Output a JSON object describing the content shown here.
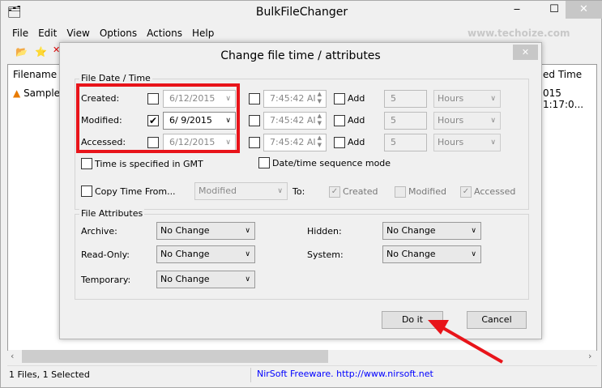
{
  "window": {
    "title": "BulkFileChanger",
    "minimize": "‒",
    "maximize": "☐",
    "close": "✕"
  },
  "menu": [
    "File",
    "Edit",
    "View",
    "Options",
    "Actions",
    "Help"
  ],
  "watermark": "www.techoize.com",
  "list": {
    "headers": [
      "Filename",
      "ed Time"
    ],
    "row": {
      "filename": "Sample",
      "time": "015 1:17:0..."
    }
  },
  "status": {
    "left": "1 Files, 1 Selected",
    "right": "NirSoft Freeware.  http://www.nirsoft.net"
  },
  "dialog": {
    "title": "Change file time / attributes",
    "close": "✕",
    "date_group": "File Date / Time",
    "rows": [
      {
        "label": "Created:",
        "checked": false,
        "date": "6/12/2015",
        "time": "7:45:42 AI",
        "add": "Add",
        "amount": "5",
        "unit": "Hours"
      },
      {
        "label": "Modified:",
        "checked": true,
        "date": "6/  9/2015",
        "time": "7:45:42 AI",
        "add": "Add",
        "amount": "5",
        "unit": "Hours"
      },
      {
        "label": "Accessed:",
        "checked": false,
        "date": "6/12/2015",
        "time": "7:45:42 AI",
        "add": "Add",
        "amount": "5",
        "unit": "Hours"
      }
    ],
    "gmt": "Time is specified in GMT",
    "sequence": "Date/time sequence mode",
    "copy_from": "Copy Time From...",
    "copy_source": "Modified",
    "to": "To:",
    "targets": [
      {
        "label": "Created",
        "checked": true
      },
      {
        "label": "Modified",
        "checked": false
      },
      {
        "label": "Accessed",
        "checked": true
      }
    ],
    "attr_group": "File Attributes",
    "attrs": [
      {
        "label": "Archive:",
        "value": "No Change"
      },
      {
        "label": "Hidden:",
        "value": "No Change"
      },
      {
        "label": "Read-Only:",
        "value": "No Change"
      },
      {
        "label": "System:",
        "value": "No Change"
      },
      {
        "label": "Temporary:",
        "value": "No Change"
      }
    ],
    "do_it": "Do it",
    "cancel": "Cancel"
  },
  "colors": {
    "highlight": "#e8141a",
    "link": "#0000ff"
  }
}
